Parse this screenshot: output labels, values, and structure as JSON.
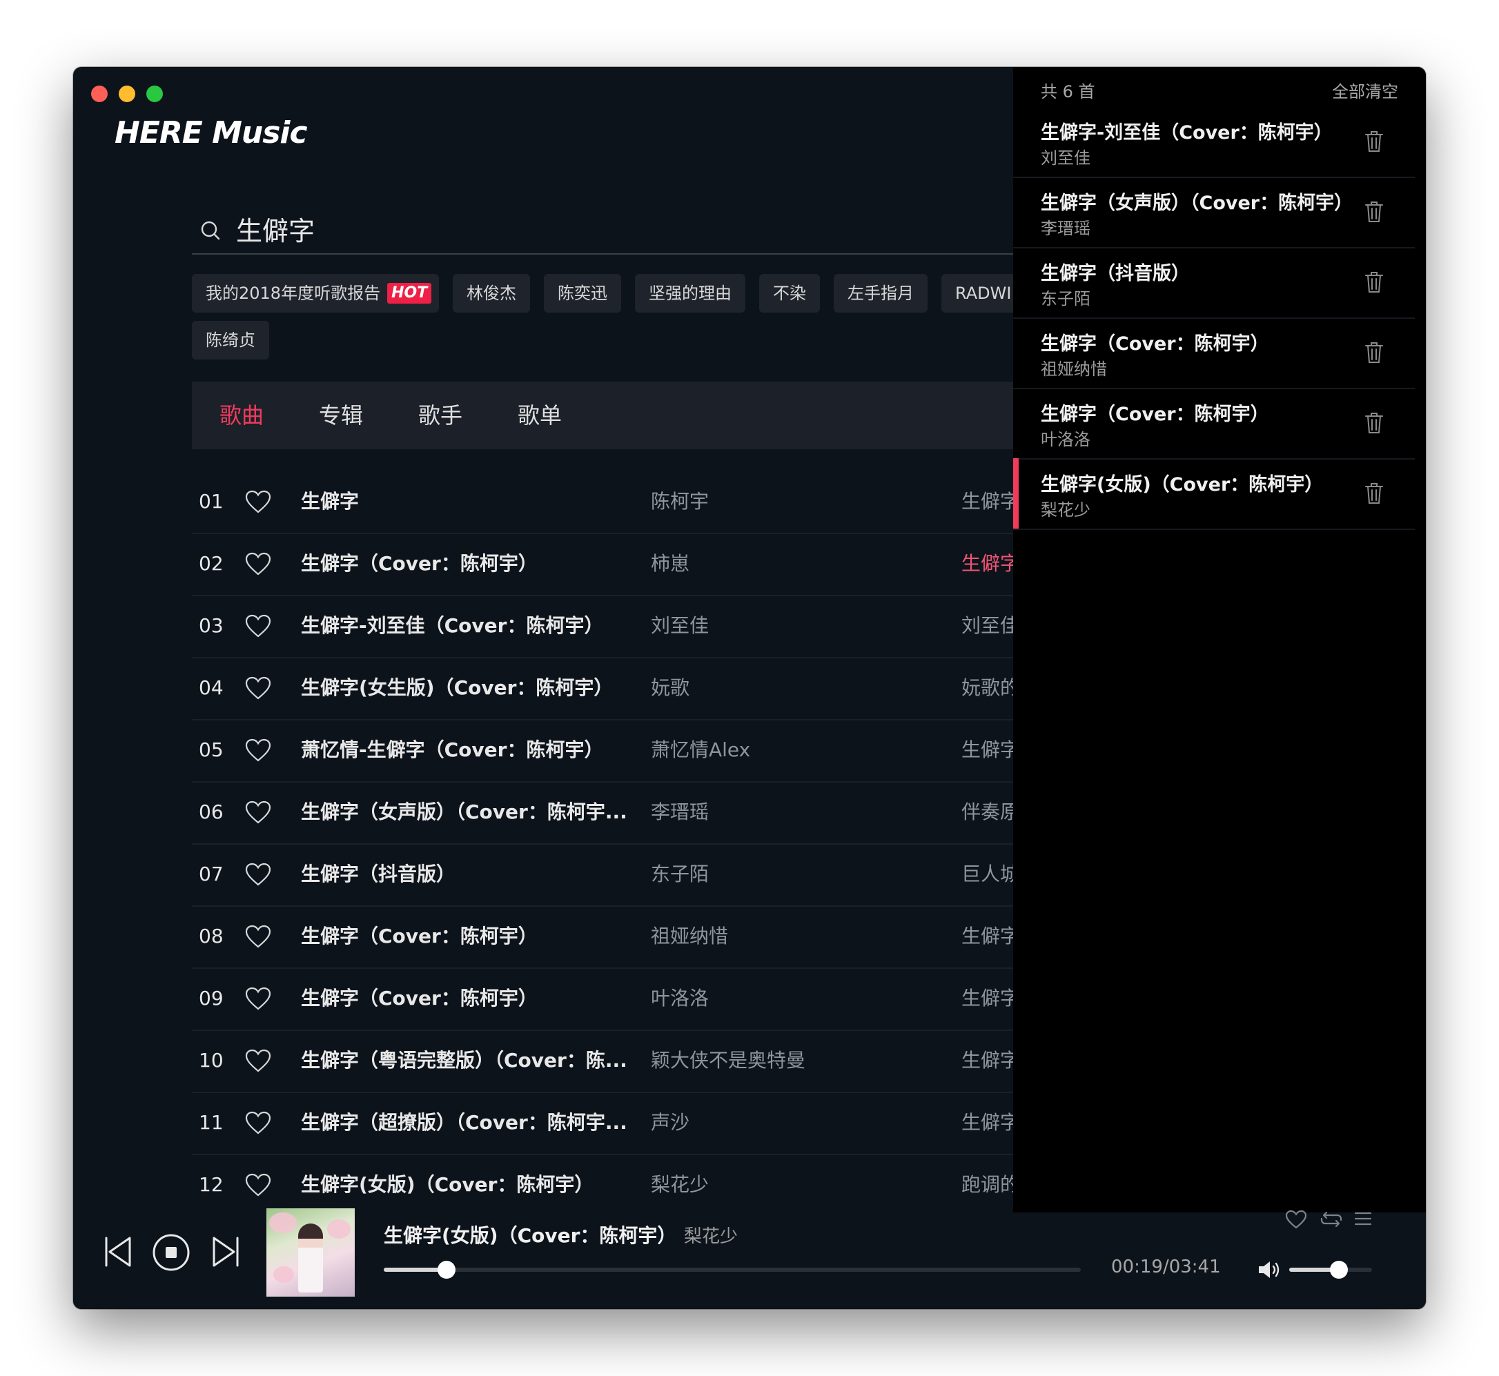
{
  "app": {
    "title": "HERE Music"
  },
  "search": {
    "query": "生僻字"
  },
  "tags": [
    {
      "label": "我的2018年度听歌报告",
      "badge": "HOT"
    },
    {
      "label": "林俊杰"
    },
    {
      "label": "陈奕迅"
    },
    {
      "label": "坚强的理由"
    },
    {
      "label": "不染"
    },
    {
      "label": "左手指月"
    },
    {
      "label": "RADWI"
    },
    {
      "label": "陈绮贞"
    }
  ],
  "tabs": [
    {
      "label": "歌曲",
      "active": true
    },
    {
      "label": "专辑"
    },
    {
      "label": "歌手"
    },
    {
      "label": "歌单"
    }
  ],
  "songs": [
    {
      "num": "01",
      "title": "生僻字",
      "artist": "陈柯宇",
      "album": "生僻字"
    },
    {
      "num": "02",
      "title": "生僻字（Cover：陈柯宇）",
      "artist": "柿崽",
      "album": "生僻字"
    },
    {
      "num": "03",
      "title": "生僻字-刘至佳（Cover：陈柯宇）",
      "artist": "刘至佳",
      "album": "刘至佳"
    },
    {
      "num": "04",
      "title": "生僻字(女生版)（Cover：陈柯宇）",
      "artist": "妧歌",
      "album": "妧歌的"
    },
    {
      "num": "05",
      "title": "萧忆情-生僻字（Cover：陈柯宇）",
      "artist": "萧忆情Alex",
      "album": "生僻字"
    },
    {
      "num": "06",
      "title": "生僻字（女声版）（Cover：陈柯宇...",
      "artist": "李瑨瑶",
      "album": "伴奏原"
    },
    {
      "num": "07",
      "title": "生僻字（抖音版）",
      "artist": "东子陌",
      "album": "巨人城"
    },
    {
      "num": "08",
      "title": "生僻字（Cover：陈柯宇）",
      "artist": "祖娅纳惜",
      "album": "生僻字"
    },
    {
      "num": "09",
      "title": "生僻字（Cover：陈柯宇）",
      "artist": "叶洛洛",
      "album": "生僻字"
    },
    {
      "num": "10",
      "title": "生僻字（粤语完整版）（Cover：陈...",
      "artist": "颖大侠不是奥特曼",
      "album": "生僻字"
    },
    {
      "num": "11",
      "title": "生僻字（超撩版）（Cover：陈柯宇...",
      "artist": "声沙",
      "album": "生僻字"
    },
    {
      "num": "12",
      "title": "生僻字(女版)（Cover：陈柯宇）",
      "artist": "梨花少",
      "album": "跑调的"
    }
  ],
  "queue": {
    "count_label": "共 6 首",
    "clear_label": "全部清空",
    "items": [
      {
        "title": "生僻字-刘至佳（Cover：陈柯宇）",
        "artist": "刘至佳"
      },
      {
        "title": "生僻字（女声版）（Cover：陈柯宇）",
        "artist": "李瑨瑶"
      },
      {
        "title": "生僻字（抖音版）",
        "artist": "东子陌"
      },
      {
        "title": "生僻字（Cover：陈柯宇）",
        "artist": "祖娅纳惜"
      },
      {
        "title": "生僻字（Cover：陈柯宇）",
        "artist": "叶洛洛"
      },
      {
        "title": "生僻字(女版)（Cover：陈柯宇）",
        "artist": "梨花少",
        "current": true
      }
    ]
  },
  "player": {
    "title": "生僻字(女版)（Cover：陈柯宇）",
    "artist": "梨花少",
    "current_time": "00:19",
    "separator": "/",
    "total_time": "03:41",
    "progress_fraction": 0.09,
    "volume_fraction": 0.6
  },
  "icons": {
    "player_controls": [
      "previous-icon",
      "stop-icon",
      "next-icon"
    ],
    "player_extras": [
      "heart-icon",
      "repeat-icon",
      "playlist-icon",
      "volume-icon"
    ]
  },
  "colors": {
    "accent": "#ef3c5d",
    "background": "#0d131b",
    "queue_background": "#000000"
  }
}
